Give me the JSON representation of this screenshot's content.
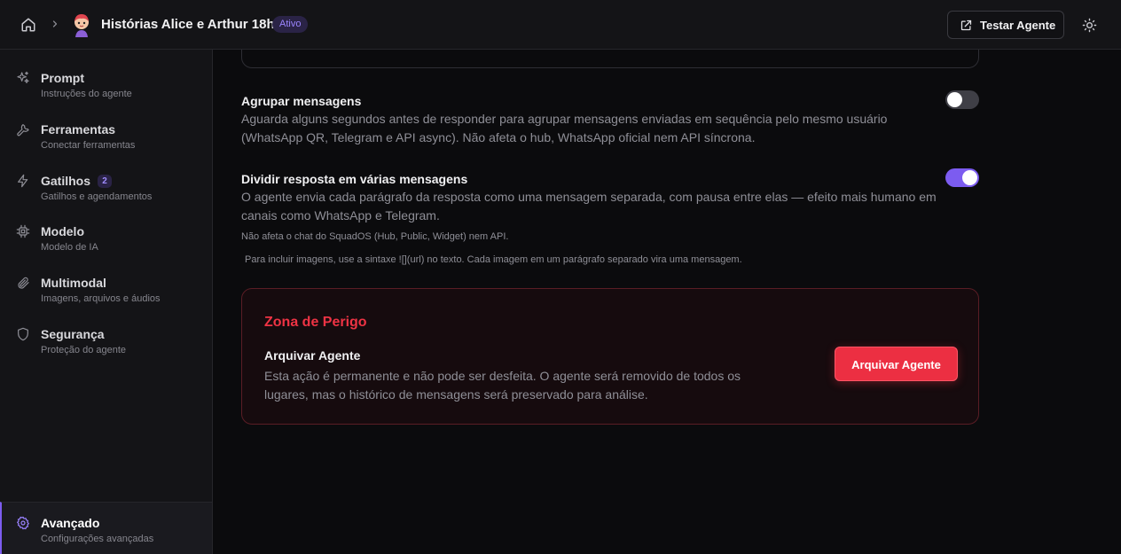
{
  "header": {
    "agent_name": "Histórias Alice e Arthur 18h",
    "status": "Ativo",
    "test_button": "Testar Agente"
  },
  "sidebar": {
    "items": [
      {
        "title": "Prompt",
        "subtitle": "Instruções do agente",
        "icon": "sparkles-icon"
      },
      {
        "title": "Ferramentas",
        "subtitle": "Conectar ferramentas",
        "icon": "wrench-icon"
      },
      {
        "title": "Gatilhos",
        "subtitle": "Gatilhos e agendamentos",
        "icon": "bolt-icon",
        "badge": "2"
      },
      {
        "title": "Modelo",
        "subtitle": "Modelo de IA",
        "icon": "cpu-icon"
      },
      {
        "title": "Multimodal",
        "subtitle": "Imagens, arquivos e áudios",
        "icon": "paperclip-icon"
      },
      {
        "title": "Segurança",
        "subtitle": "Proteção do agente",
        "icon": "shield-icon"
      },
      {
        "title": "Avançado",
        "subtitle": "Configurações avançadas",
        "icon": "gear-icon",
        "active": true
      }
    ]
  },
  "settings": {
    "group_messages": {
      "title": "Agrupar mensagens",
      "description": "Aguarda alguns segundos antes de responder para agrupar mensagens enviadas em sequência pelo mesmo usuário (WhatsApp QR, Telegram e API async). Não afeta o hub, WhatsApp oficial nem API síncrona.",
      "enabled": false
    },
    "split_response": {
      "title": "Dividir resposta em várias mensagens",
      "description": "O agente envia cada parágrafo da resposta como uma mensagem separada, com pausa entre elas — efeito mais humano em canais como WhatsApp e Telegram.",
      "note": "Não afeta o chat do SquadOS (Hub, Public, Widget) nem API.",
      "enabled": true
    },
    "image_hint": "Para incluir imagens, use a sintaxe ![](url) no texto. Cada imagem em um parágrafo separado vira uma mensagem."
  },
  "danger_zone": {
    "title": "Zona de Perigo",
    "archive_title": "Arquivar Agente",
    "archive_description": "Esta ação é permanente e não pode ser desfeita. O agente será removido de todos os lugares, mas o histórico de mensagens será preservado para análise.",
    "archive_button": "Arquivar Agente"
  },
  "colors": {
    "accent": "#7c5cf0",
    "danger": "#ec2f42",
    "background": "#0b0b0d",
    "panel": "#141417"
  }
}
